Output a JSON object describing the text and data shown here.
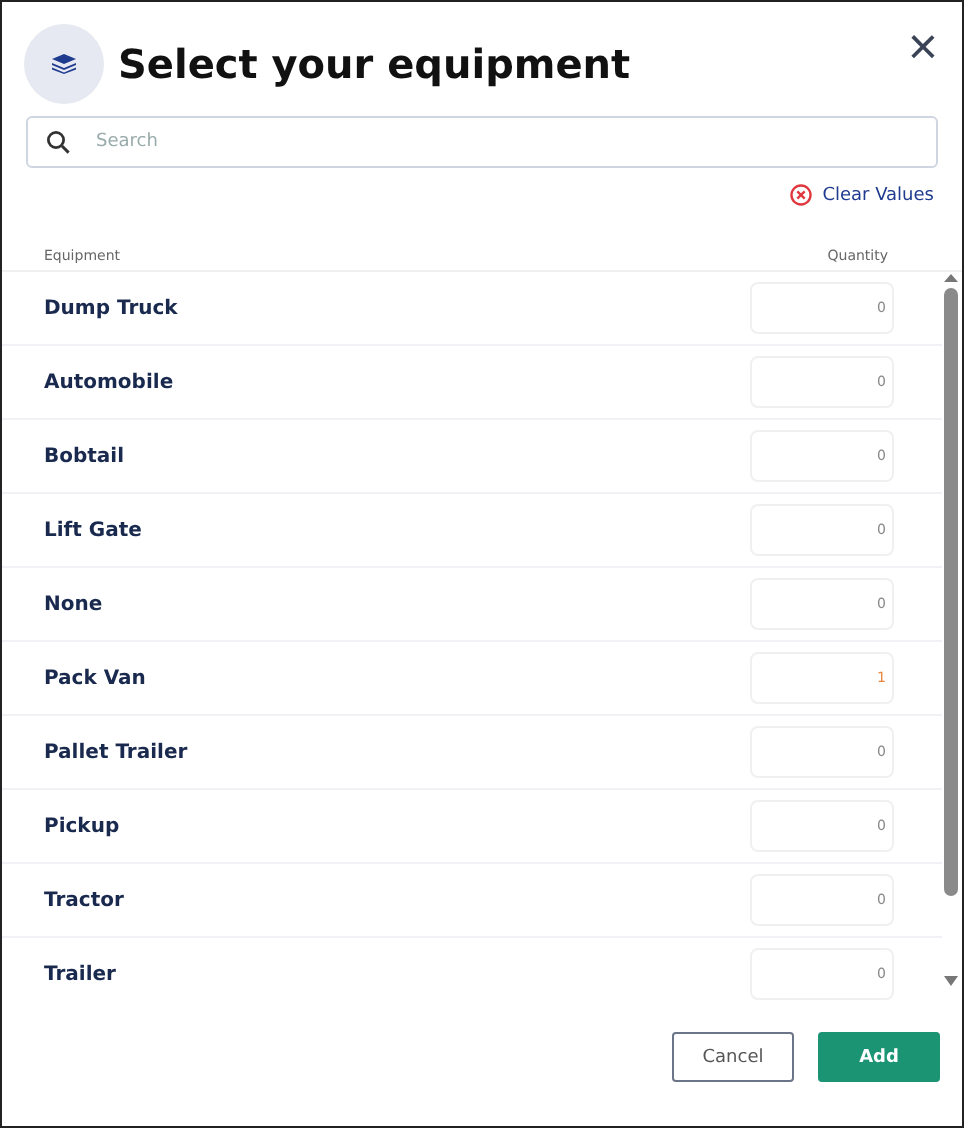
{
  "dialog": {
    "title": "Select your equipment",
    "close": "×"
  },
  "search": {
    "placeholder": "Search"
  },
  "clear_values": "Clear Values",
  "table": {
    "columns": [
      "Equipment",
      "Quantity"
    ],
    "rows": [
      {
        "name": "Dump Truck",
        "quantity": "0",
        "changed": false
      },
      {
        "name": "Automobile",
        "quantity": "0",
        "changed": false
      },
      {
        "name": "Bobtail",
        "quantity": "0",
        "changed": false
      },
      {
        "name": "Lift Gate",
        "quantity": "0",
        "changed": false
      },
      {
        "name": "None",
        "quantity": "0",
        "changed": false
      },
      {
        "name": "Pack Van",
        "quantity": "1",
        "changed": true
      },
      {
        "name": "Pallet Trailer",
        "quantity": "0",
        "changed": false
      },
      {
        "name": "Pickup",
        "quantity": "0",
        "changed": false
      },
      {
        "name": "Tractor",
        "quantity": "0",
        "changed": false
      },
      {
        "name": "Trailer",
        "quantity": "0",
        "changed": false
      }
    ]
  },
  "buttons": {
    "cancel": "Cancel",
    "add": "Add"
  }
}
